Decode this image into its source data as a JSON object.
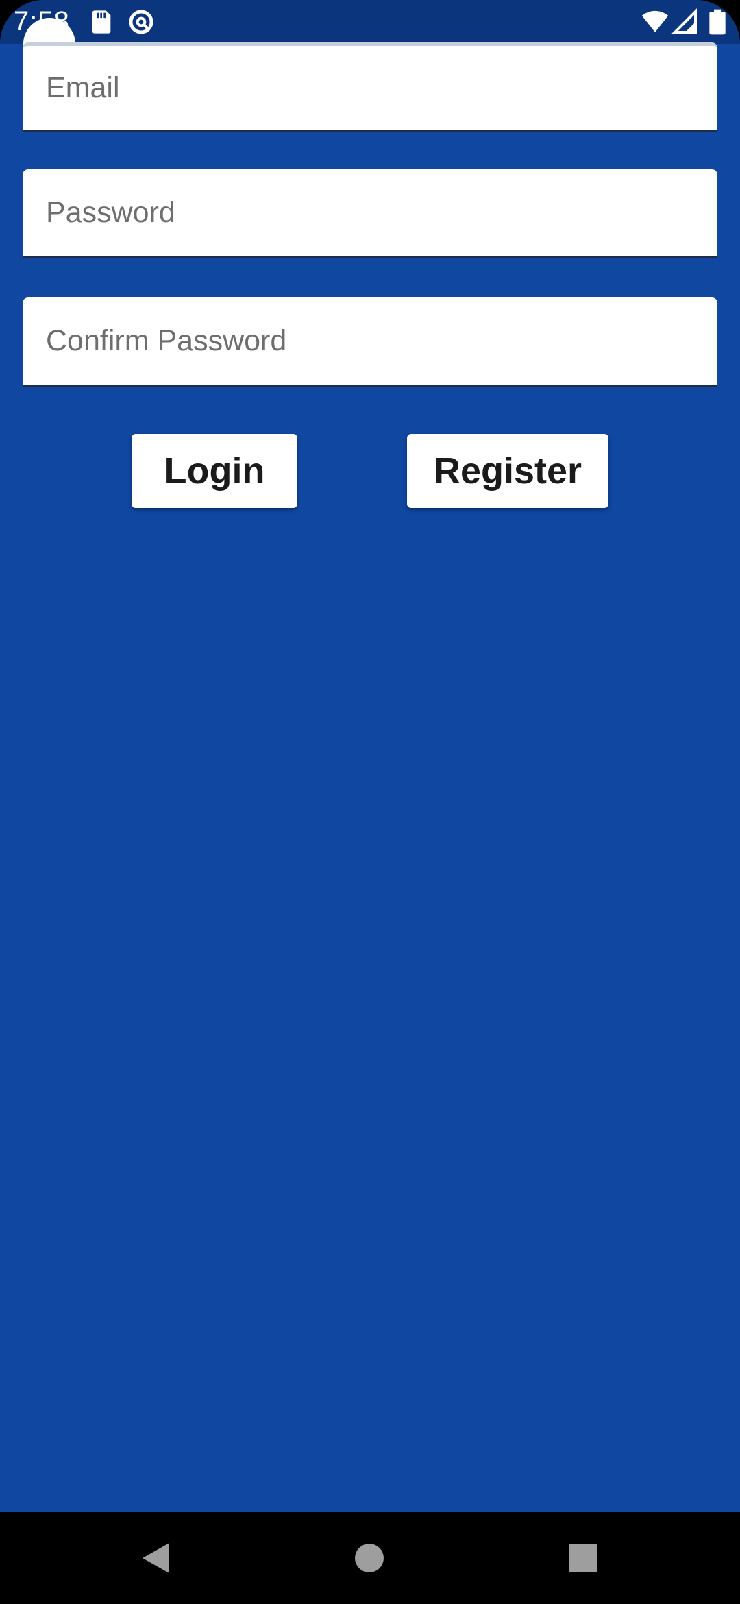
{
  "status_bar": {
    "time": "7:58",
    "icons": [
      "sd-card-icon",
      "data-saver-icon",
      "wifi-icon",
      "cell-signal-icon",
      "battery-icon"
    ]
  },
  "form": {
    "email": {
      "placeholder": "Email",
      "value": ""
    },
    "password": {
      "placeholder": "Password",
      "value": ""
    },
    "confirm_password": {
      "placeholder": "Confirm Password",
      "value": ""
    }
  },
  "buttons": {
    "login": "Login",
    "register": "Register"
  },
  "nav_bar": {
    "icons": [
      "back-icon",
      "home-icon",
      "recents-icon"
    ]
  },
  "colors": {
    "background": "#0F47A1",
    "status_bar": "#0B357D",
    "field_background": "#FFFFFF",
    "button_background": "#FFFFFF",
    "button_text": "#1B1B1B",
    "placeholder_text": "#6E6E6E",
    "nav_bar": "#000000"
  }
}
